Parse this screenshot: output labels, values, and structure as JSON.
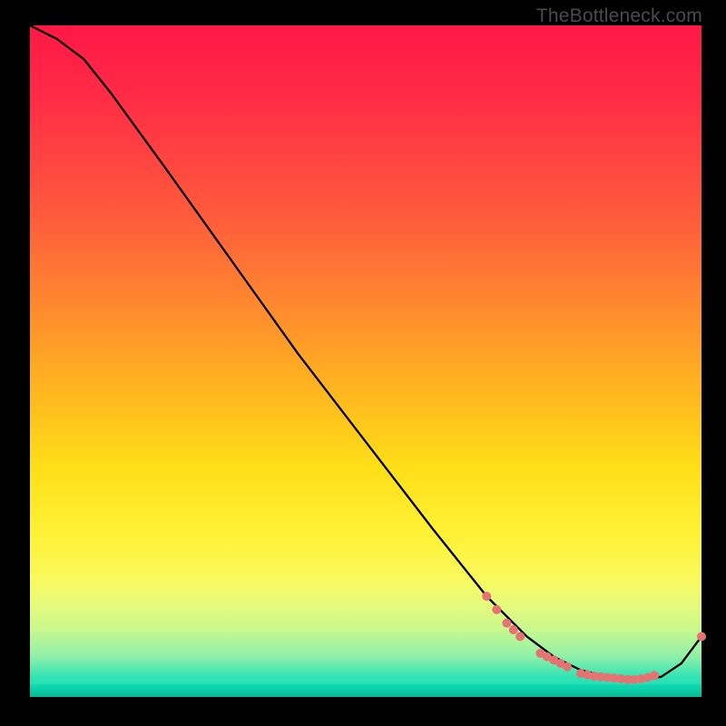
{
  "attribution": "TheBottleneck.com",
  "chart_data": {
    "type": "line",
    "title": "",
    "xlabel": "",
    "ylabel": "",
    "xlim": [
      0,
      100
    ],
    "ylim": [
      0,
      100
    ],
    "grid": false,
    "legend": false,
    "series": [
      {
        "name": "curve",
        "x": [
          0,
          4,
          8,
          12,
          20,
          30,
          40,
          50,
          60,
          68,
          74,
          78,
          82,
          86,
          90,
          94,
          97,
          100
        ],
        "y": [
          100,
          98,
          95,
          90,
          79,
          65,
          51,
          38,
          25,
          15,
          9,
          6,
          4,
          3,
          2.5,
          3,
          5,
          9
        ],
        "color": "#000000"
      }
    ],
    "markers": {
      "name": "dots",
      "color": "#e57373",
      "radius_px": 5,
      "points_xy": [
        [
          68,
          15.0
        ],
        [
          69.5,
          13.0
        ],
        [
          71.0,
          11.0
        ],
        [
          72.0,
          10.0
        ],
        [
          73.0,
          9.0
        ],
        [
          76.0,
          6.5
        ],
        [
          77.0,
          6.0
        ],
        [
          78.0,
          5.5
        ],
        [
          79.0,
          5.0
        ],
        [
          80.0,
          4.5
        ],
        [
          82.0,
          3.5
        ],
        [
          83.0,
          3.3
        ],
        [
          84.0,
          3.1
        ],
        [
          85.0,
          3.0
        ],
        [
          86.0,
          2.9
        ],
        [
          87.0,
          2.8
        ],
        [
          88.0,
          2.7
        ],
        [
          89.0,
          2.6
        ],
        [
          90.0,
          2.6
        ],
        [
          91.0,
          2.7
        ],
        [
          92.0,
          2.9
        ],
        [
          93.0,
          3.2
        ],
        [
          100.0,
          9.0
        ]
      ]
    }
  }
}
